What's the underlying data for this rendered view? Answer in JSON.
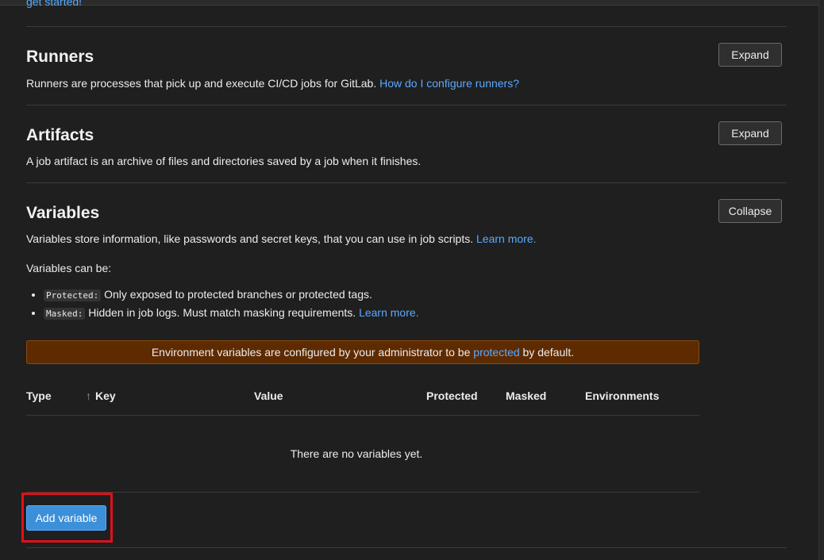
{
  "top": {
    "link": "get started!"
  },
  "runners": {
    "title": "Runners",
    "description": "Runners are processes that pick up and execute CI/CD jobs for GitLab.",
    "link": "How do I configure runners?",
    "button": "Expand"
  },
  "artifacts": {
    "title": "Artifacts",
    "description": "A job artifact is an archive of files and directories saved by a job when it finishes.",
    "button": "Expand"
  },
  "variables": {
    "title": "Variables",
    "description": "Variables store information, like passwords and secret keys, that you can use in job scripts.",
    "link": "Learn more.",
    "button": "Collapse",
    "can_be": "Variables can be:",
    "types": [
      {
        "code": "Protected:",
        "text": "Only exposed to protected branches or protected tags."
      },
      {
        "code": "Masked:",
        "text": "Hidden in job logs. Must match masking requirements.",
        "link": "Learn more."
      }
    ],
    "alert": {
      "before": "Environment variables are configured by your administrator to be",
      "link": "protected",
      "after": "by default."
    },
    "table": {
      "headers": [
        "Type",
        "Key",
        "Value",
        "Protected",
        "Masked",
        "Environments"
      ],
      "empty": "There are no variables yet."
    },
    "add_button": "Add variable"
  },
  "colors": {
    "background": "#1f1f1f",
    "link": "#5aa9ff",
    "primary": "#3c8fd9",
    "alert_bg": "#5e2b00",
    "highlight": "#e0101a"
  },
  "icons": {
    "sort": "arrow-up-icon"
  }
}
